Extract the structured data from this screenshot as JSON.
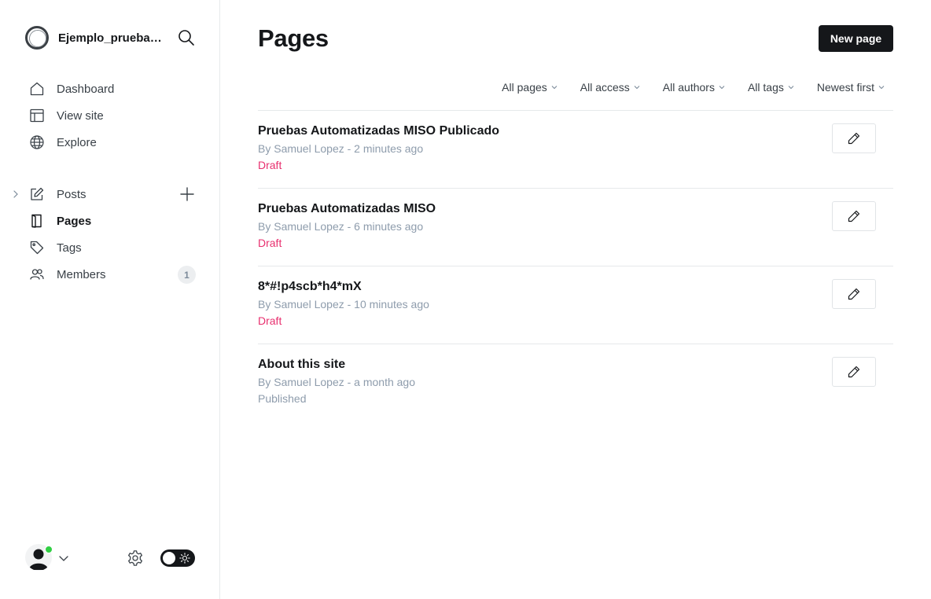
{
  "sidebar": {
    "site_name": "Ejemplo_prueba…",
    "nav_primary": [
      {
        "label": "Dashboard",
        "icon": "home-icon"
      },
      {
        "label": "View site",
        "icon": "layout-icon"
      },
      {
        "label": "Explore",
        "icon": "globe-icon"
      }
    ],
    "nav_secondary": [
      {
        "label": "Posts",
        "icon": "pencil-square-icon"
      },
      {
        "label": "Pages",
        "icon": "page-icon",
        "active": true
      },
      {
        "label": "Tags",
        "icon": "tag-icon"
      },
      {
        "label": "Members",
        "icon": "members-icon",
        "count": "1"
      }
    ]
  },
  "header": {
    "title": "Pages",
    "new_button": "New page"
  },
  "filters": [
    "All pages",
    "All access",
    "All authors",
    "All tags",
    "Newest first"
  ],
  "pages": [
    {
      "title": "Pruebas Automatizadas MISO Publicado",
      "meta": "By Samuel Lopez - 2 minutes ago",
      "status": "Draft"
    },
    {
      "title": "Pruebas Automatizadas MISO",
      "meta": "By Samuel Lopez - 6 minutes ago",
      "status": "Draft"
    },
    {
      "title": "8*#!p4scb*h4*mX",
      "meta": "By Samuel Lopez - 10 minutes ago",
      "status": "Draft"
    },
    {
      "title": "About this site",
      "meta": "By Samuel Lopez - a month ago",
      "status": "Published"
    }
  ],
  "colors": {
    "draft": "#e8306f",
    "published": "#8e9cac",
    "online": "#30cf43",
    "primary_button": "#15171a"
  }
}
